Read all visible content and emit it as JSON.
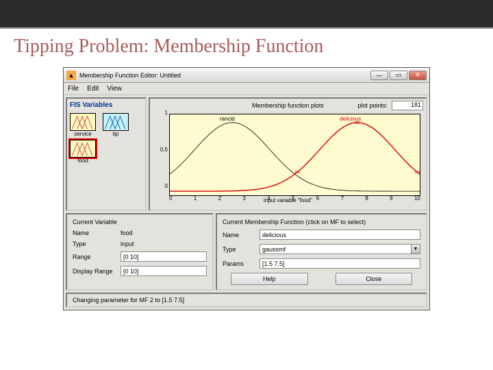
{
  "slide": {
    "title": "Tipping Problem: Membership Function"
  },
  "window": {
    "title": "Membership Function Editor: Untitled"
  },
  "menubar": {
    "file": "File",
    "edit": "Edit",
    "view": "View"
  },
  "fispanel": {
    "title": "FIS Variables",
    "vars": {
      "service": "service",
      "tip": "tip",
      "food": "food"
    }
  },
  "plot": {
    "title": "Membership function plots",
    "plotpoints_label": "plot points:",
    "plotpoints_value": "181",
    "mf1": "rancid",
    "mf2": "delicious",
    "xlabel": "input variable \"food\"",
    "xticks": [
      "0",
      "1",
      "2",
      "3",
      "4",
      "5",
      "6",
      "7",
      "8",
      "9",
      "10"
    ],
    "yticks": [
      "1",
      "0.5",
      "0"
    ]
  },
  "curvar": {
    "heading": "Current Variable",
    "name_label": "Name",
    "name_value": "food",
    "type_label": "Type",
    "type_value": "input",
    "range_label": "Range",
    "range_value": "[0 10]",
    "disprange_label": "Display Range",
    "disprange_value": "[0 10]"
  },
  "curmf": {
    "heading": "Current Membership Function (click on MF to select)",
    "name_label": "Name",
    "name_value": "delicious",
    "type_label": "Type",
    "type_value": "gaussmf",
    "params_label": "Params",
    "params_value": "[1.5 7.5]"
  },
  "buttons": {
    "help": "Help",
    "close": "Close"
  },
  "status": {
    "text": "Changing parameter for MF 2 to  [1.5 7.5]"
  },
  "chart_data": {
    "type": "line",
    "xlabel": "input variable \"food\"",
    "ylabel": "",
    "xlim": [
      0,
      10
    ],
    "ylim": [
      0,
      1
    ],
    "series": [
      {
        "name": "rancid",
        "type": "gaussmf",
        "sigma": 1.5,
        "center": 2.5,
        "color": "#000000"
      },
      {
        "name": "delicious",
        "type": "gaussmf",
        "sigma": 1.5,
        "center": 7.5,
        "color": "#d40000",
        "selected": true
      }
    ]
  }
}
